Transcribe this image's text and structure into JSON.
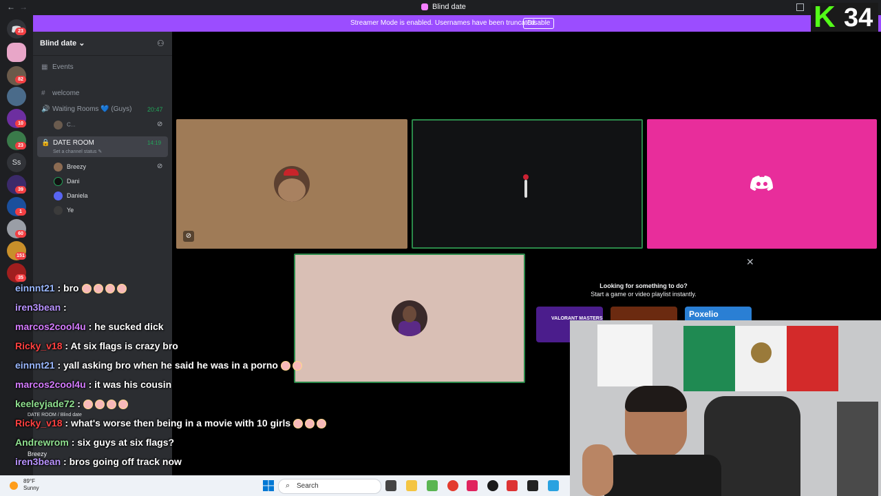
{
  "window": {
    "title": "Blind date",
    "back": "←",
    "forward": "→"
  },
  "banner": {
    "message": "Streamer Mode is enabled. Usernames have been truncated.",
    "button": "Disable"
  },
  "kick_badge": {
    "logo": "K",
    "viewers": "34"
  },
  "guild_badges": [
    "23",
    "82",
    "10",
    "23",
    "39",
    "1",
    "60",
    "151",
    "35"
  ],
  "guild_text_icon": "Ss",
  "server": {
    "name": "Blind date ⌄"
  },
  "channels": {
    "events": "Events",
    "welcome": "welcome",
    "waiting_room": "Waiting Rooms 💙 (Guys)",
    "waiting_time": "20:47",
    "waiting_member": "C...",
    "date_room": "DATE ROOM",
    "date_status": "Set a channel status ✎",
    "date_time": "14:19",
    "members": [
      "Breezy",
      "Dani",
      "Daniela",
      "Ye"
    ]
  },
  "promo": {
    "heading": "Looking for something to do?",
    "sub": "Start a game or video playlist instantly.",
    "cards": [
      "VALORANT MASTERS",
      "",
      "Poxelio"
    ]
  },
  "close_icon": "✕",
  "chat": [
    {
      "user": "einnnt21",
      "msg": ": bro",
      "emojis": 4,
      "color": "#9ab8ff"
    },
    {
      "user": "iren3bean",
      "msg": ":",
      "emojis": 0,
      "color": "#b993ff"
    },
    {
      "user": "marcos2cool4u",
      "msg": ": he sucked dick",
      "emojis": 0,
      "color": "#d57bff"
    },
    {
      "user": "Ricky_v18",
      "msg": ": At six flags is crazy bro",
      "emojis": 0,
      "color": "#ff4040"
    },
    {
      "user": "einnnt21",
      "msg": ": yall asking bro when he said he was in a porno",
      "emojis": 2,
      "color": "#9ab8ff"
    },
    {
      "user": "marcos2cool4u",
      "msg": ": it was his cousin",
      "emojis": 0,
      "color": "#d57bff"
    },
    {
      "user": "keeleyjade72",
      "msg": ":",
      "emojis": 4,
      "color": "#8fe08f"
    },
    {
      "user": "Ricky_v18",
      "msg": ": what's worse then being in a movie with 10 girls",
      "emojis": 3,
      "color": "#ff4040"
    },
    {
      "user": "Andrewrom",
      "msg": ": six guys at six flags?",
      "emojis": 0,
      "color": "#8fe08f"
    },
    {
      "user": "iren3bean",
      "msg": ": bros going off track now",
      "emojis": 0,
      "color": "#b993ff"
    }
  ],
  "voice_panel": {
    "channel": "DATE ROOM / Blind date",
    "user": "Breezy"
  },
  "taskbar": {
    "temp": "89°F",
    "condition": "Sunny",
    "search": "Search"
  },
  "colors": {
    "accent": "#9b4dff",
    "kick": "#53fc18",
    "discord_tile": "#e82d9b",
    "speaking": "#23a55a"
  }
}
